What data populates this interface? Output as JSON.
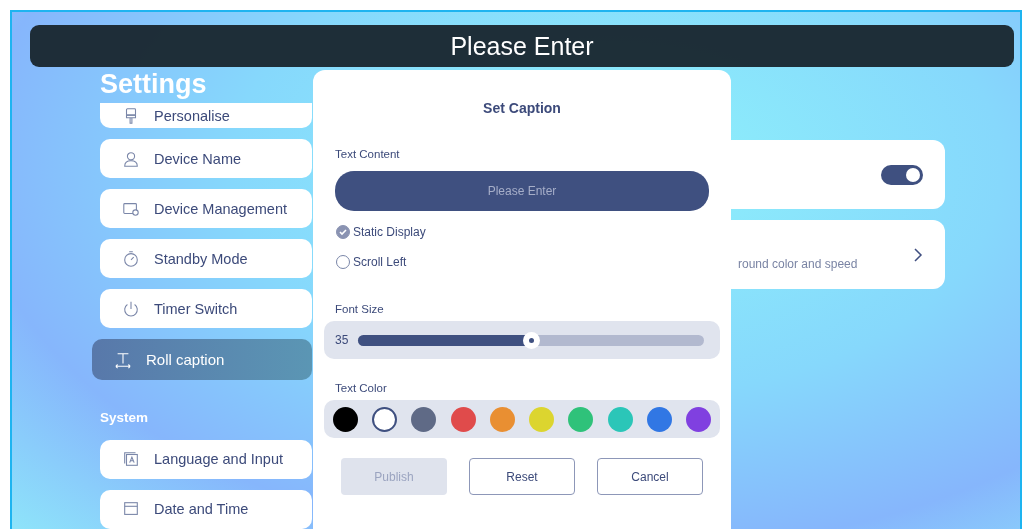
{
  "banner": {
    "text": "Please Enter"
  },
  "settings": {
    "title": "Settings",
    "groups": [
      {
        "items": [
          {
            "label": "Personalise",
            "selected": false
          },
          {
            "label": "Device Name",
            "selected": false
          },
          {
            "label": "Device Management",
            "selected": false
          },
          {
            "label": "Standby Mode",
            "selected": false
          },
          {
            "label": "Timer Switch",
            "selected": false
          },
          {
            "label": "Roll caption",
            "selected": true
          }
        ]
      },
      {
        "header": "System",
        "items": [
          {
            "label": "Language and Input",
            "selected": false
          },
          {
            "label": "Date and Time",
            "selected": false
          }
        ]
      }
    ]
  },
  "panel_cards": [
    {
      "kind": "toggle",
      "on": true
    },
    {
      "kind": "link",
      "description": "round color and speed"
    }
  ],
  "dialog": {
    "title": "Set Caption",
    "text_content": {
      "label": "Text Content",
      "placeholder": "Please Enter"
    },
    "display_modes": [
      {
        "label": "Static Display",
        "selected": true
      },
      {
        "label": "Scroll Left",
        "selected": false
      }
    ],
    "font_size": {
      "label": "Font Size",
      "value": "35",
      "level": 0.5
    },
    "text_color": {
      "label": "Text Color",
      "swatches": [
        {
          "color": "#000000",
          "selected": false
        },
        {
          "color": "#ffffff",
          "selected": true
        },
        {
          "color": "#5f6a86",
          "selected": false
        },
        {
          "color": "#e04b4b",
          "selected": false
        },
        {
          "color": "#e98f32",
          "selected": false
        },
        {
          "color": "#dcd52f",
          "selected": false
        },
        {
          "color": "#2fc27a",
          "selected": false
        },
        {
          "color": "#2bc6b8",
          "selected": false
        },
        {
          "color": "#3177e4",
          "selected": false
        },
        {
          "color": "#8040e0",
          "selected": false
        }
      ]
    },
    "buttons": [
      {
        "label": "Publish",
        "disabled": true
      },
      {
        "label": "Reset",
        "disabled": false
      },
      {
        "label": "Cancel",
        "disabled": false
      }
    ]
  }
}
